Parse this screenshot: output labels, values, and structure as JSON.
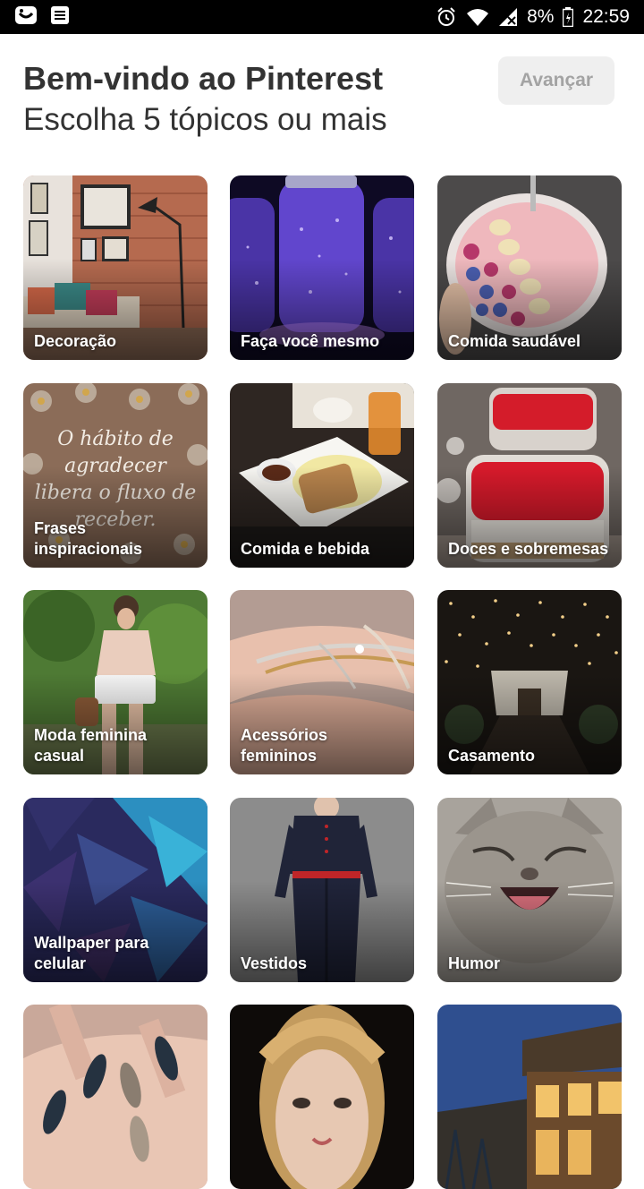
{
  "status_bar": {
    "battery": "8%",
    "time": "22:59"
  },
  "header": {
    "title": "Bem-vindo ao Pinterest",
    "subtitle": "Escolha 5 tópicos ou mais",
    "next_label": "Avançar"
  },
  "topics": [
    {
      "label": "Decoração"
    },
    {
      "label": "Faça você mesmo"
    },
    {
      "label": "Comida saudável"
    },
    {
      "label": "Frases inspiracionais"
    },
    {
      "label": "Comida e bebida"
    },
    {
      "label": "Doces e sobremesas"
    },
    {
      "label": "Moda feminina casual"
    },
    {
      "label": "Acessórios femininos"
    },
    {
      "label": "Casamento"
    },
    {
      "label": "Wallpaper para celular"
    },
    {
      "label": "Vestidos"
    },
    {
      "label": "Humor"
    },
    {
      "label": ""
    },
    {
      "label": ""
    },
    {
      "label": ""
    }
  ],
  "tile_texts": {
    "quote": "O hábito de agradecer libera o fluxo de receber."
  },
  "colors": {
    "button_bg": "#efefef",
    "button_text": "#a3a3a3",
    "title_text": "#333333"
  }
}
